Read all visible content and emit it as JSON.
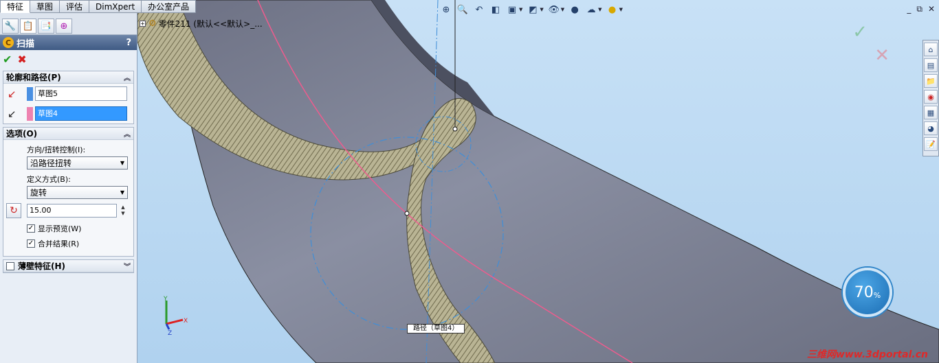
{
  "command_tabs": [
    "特征",
    "草图",
    "评估",
    "DimXpert",
    "办公室产品"
  ],
  "active_tab_index": 0,
  "feature_manager_tabs": [
    "feature-tree",
    "property-manager",
    "configuration-manager",
    "dimxpert-manager"
  ],
  "property_manager": {
    "title": "扫描",
    "help": "?",
    "profile_group": {
      "title": "轮廓和路径(P)",
      "profile_value": "草图5",
      "path_value": "草图4",
      "profile_color": "#4a90e2",
      "path_color": "#ee82b0"
    },
    "options_group": {
      "title": "选项(O)",
      "orientation_label": "方向/扭转控制(I):",
      "orientation_value": "沿路径扭转",
      "define_label": "定义方式(B):",
      "define_value": "旋转",
      "turns_value": "15.00",
      "show_preview_label": "显示预览(W)",
      "show_preview_checked": true,
      "merge_result_label": "合并结果(R)",
      "merge_result_checked": true
    },
    "thin_feature_group": {
      "title": "薄壁特征(H)",
      "checked": false
    }
  },
  "viewport": {
    "tree_root": "零件211  (默认<<默认>_...",
    "path_tag": "路径（草图4）",
    "progress": {
      "value": "70",
      "unit": "%"
    },
    "watermark": "三维网www.3dportal.cn",
    "accent_path_color": "#ee5c8e",
    "sketch_color": "#3f8ed8"
  }
}
